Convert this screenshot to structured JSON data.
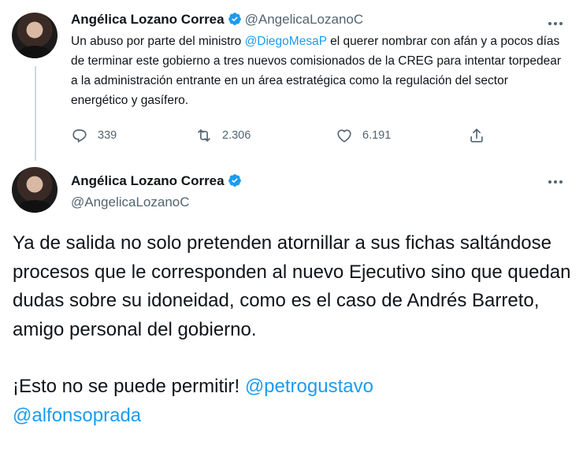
{
  "tweet1": {
    "author_name": "Angélica Lozano Correa",
    "author_handle": "@AngelicaLozanoC",
    "text_before_mention": "Un abuso por parte del ministro ",
    "mention": "@DiegoMesaP",
    "text_after_mention": " el querer nombrar con afán y a pocos días de terminar este gobierno a tres nuevos comisionados de la CREG para intentar torpedear a la administración entrante en un área estratégica como la regulación del sector energético y gasífero.",
    "replies": "339",
    "retweets": "2.306",
    "likes": "6.191"
  },
  "tweet2": {
    "author_name": "Angélica Lozano Correa",
    "author_handle": "@AngelicaLozanoC",
    "paragraph1": "Ya de salida no solo pretenden atornillar a sus fichas saltándose procesos que le corresponden al nuevo Ejecutivo sino que quedan dudas sobre su idoneidad, como es el caso de Andrés Barreto, amigo personal del gobierno.",
    "paragraph2_text": "¡Esto no se puede permitir! ",
    "mention1": "@petrogustavo",
    "mention2": "@alfonsoprada"
  },
  "icons": {
    "verified": "verified-badge-icon",
    "more": "more-options-icon",
    "reply": "reply-icon",
    "retweet": "retweet-icon",
    "like": "heart-icon",
    "share": "share-icon"
  },
  "colors": {
    "link": "#1d9bf0",
    "secondary_text": "#536471",
    "primary_text": "#0f1419",
    "verified": "#1d9bf0"
  }
}
